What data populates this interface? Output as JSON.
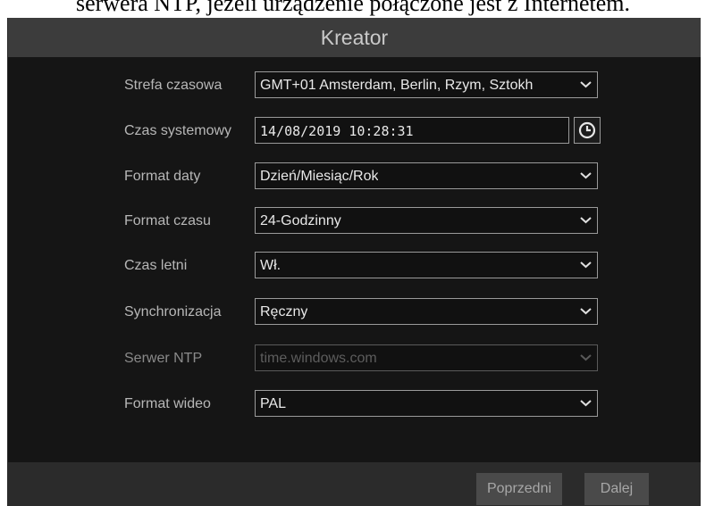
{
  "top_caption": "serwera NTP, jeżeli urządzenie połączone jest z Internetem.",
  "window": {
    "title": "Kreator"
  },
  "fields": [
    {
      "label": "Strefa czasowa",
      "value": "GMT+01 Amsterdam, Berlin, Rzym, Sztokh"
    },
    {
      "label": "Czas systemowy",
      "value": "14/08/2019 10:28:31"
    },
    {
      "label": "Format daty",
      "value": "Dzień/Miesiąc/Rok"
    },
    {
      "label": "Format czasu",
      "value": "24-Godzinny"
    },
    {
      "label": "Czas letni",
      "value": "Wł."
    },
    {
      "label": "Synchronizacja",
      "value": "Ręczny"
    },
    {
      "label": "Serwer NTP",
      "value": "time.windows.com"
    },
    {
      "label": "Format wideo",
      "value": "PAL"
    }
  ],
  "icons": {
    "dropdown": "chevron-down-icon",
    "time_picker": "clock-icon"
  },
  "footer": {
    "prev_label": "Poprzedni",
    "next_label": "Dalej"
  },
  "colors": {
    "title_bar": "#3c3c3c",
    "background": "#151515",
    "field_border": "#9a9a9a",
    "button": "#4a4a4a"
  }
}
